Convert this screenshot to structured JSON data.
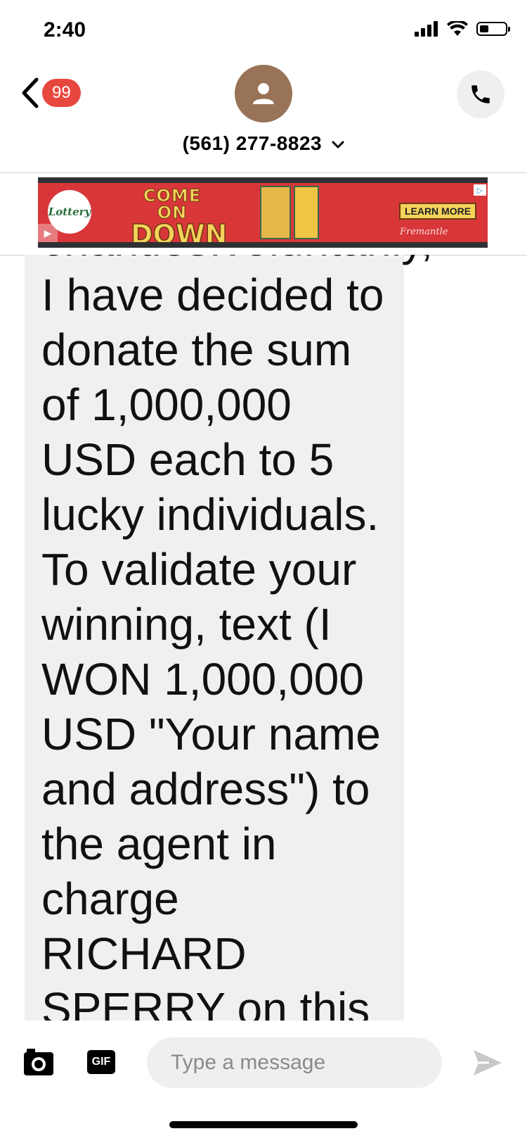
{
  "status_bar": {
    "time": "2:40",
    "battery_level": 0.35
  },
  "header": {
    "unread_count": "99",
    "contact_number": "(561) 277-8823",
    "avatar_icon": "person-icon",
    "call_icon": "phone-icon"
  },
  "ad": {
    "logo_text": "Lottery",
    "headline_line1": "COME ON",
    "headline_line2": "DOWN",
    "cta_label": "LEARN MORE",
    "brand": "Fremantle"
  },
  "conversation": {
    "message_text": "charities.voluntarily, I have decided to donate the sum of 1,000,000 USD each to 5 lucky individuals. To validate your winning, text (I WON 1,000,000 USD \"Your name and address\") to the agent in charge RICHARD SPERRY on this"
  },
  "composer": {
    "placeholder": "Type a message",
    "gif_label": "GIF",
    "camera_icon": "camera-icon",
    "send_icon": "send-icon"
  },
  "colors": {
    "badge": "#e8473f",
    "avatar": "#987357",
    "bubble": "#f0f0f0",
    "ad_background": "#d9363a"
  }
}
